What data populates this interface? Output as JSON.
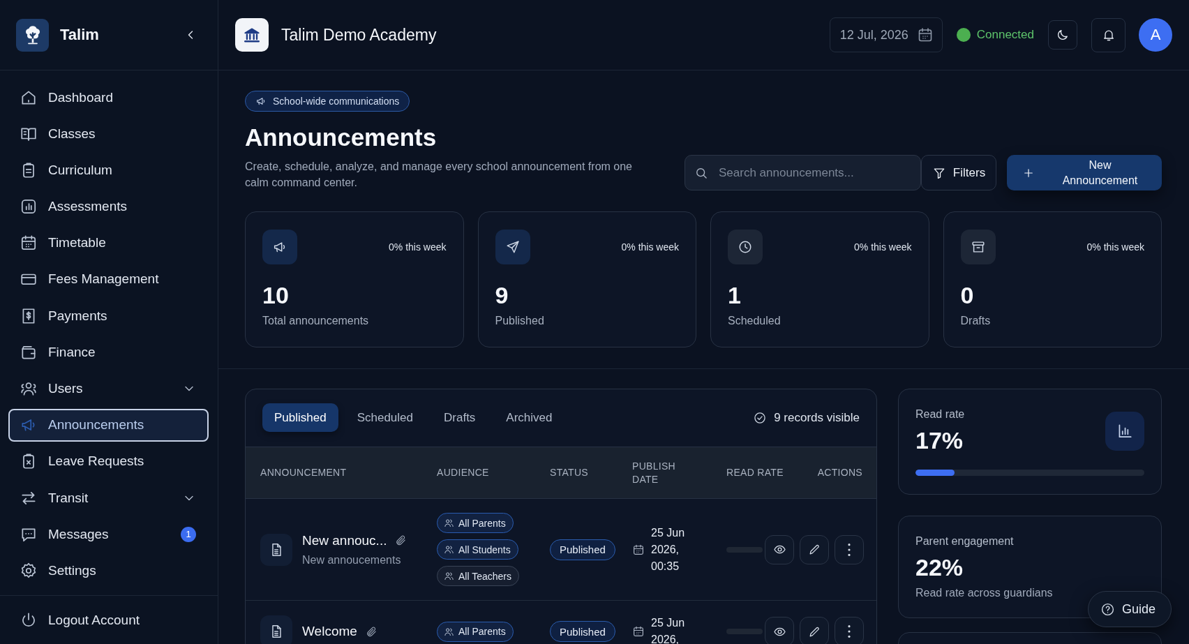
{
  "sidebar": {
    "brand": "Talim",
    "items": [
      {
        "label": "Dashboard",
        "selected": false
      },
      {
        "label": "Classes",
        "selected": false
      },
      {
        "label": "Curriculum",
        "selected": false
      },
      {
        "label": "Assessments",
        "selected": false
      },
      {
        "label": "Timetable",
        "selected": false
      },
      {
        "label": "Fees Management",
        "selected": false
      },
      {
        "label": "Payments",
        "selected": false
      },
      {
        "label": "Finance",
        "selected": false
      },
      {
        "label": "Users",
        "selected": false,
        "expanded": false
      },
      {
        "label": "Announcements",
        "selected": true
      },
      {
        "label": "Leave Requests",
        "selected": false
      },
      {
        "label": "Transit",
        "selected": false,
        "expanded": false
      },
      {
        "label": "Messages",
        "selected": false,
        "badge": "1"
      },
      {
        "label": "Settings",
        "selected": false
      }
    ],
    "logout": "Logout Account"
  },
  "header": {
    "school": "Talim Demo Academy",
    "date": "12 Jul, 2026",
    "connection": {
      "label": "Connected",
      "connected": true
    },
    "avatar": "A"
  },
  "intro": {
    "tag": "School-wide communications",
    "title": "Announcements",
    "description": "Create, schedule, analyze, and manage every school announcement from one calm command center.",
    "search": {
      "placeholder": "Search announcements..."
    },
    "filters": "Filters",
    "new_button": "New Announcement"
  },
  "stats": [
    {
      "value": "10",
      "label": "Total announcements",
      "trend": "0% this week",
      "color": "#14284a"
    },
    {
      "value": "9",
      "label": "Published",
      "trend": "0% this week",
      "color": "#14284a"
    },
    {
      "value": "1",
      "label": "Scheduled",
      "trend": "0% this week",
      "color": "#1d2636"
    },
    {
      "value": "0",
      "label": "Drafts",
      "trend": "0% this week",
      "color": "#1d2636"
    }
  ],
  "table": {
    "tabs": [
      {
        "label": "Published",
        "selected": true
      },
      {
        "label": "Scheduled",
        "selected": false
      },
      {
        "label": "Drafts",
        "selected": false
      },
      {
        "label": "Archived",
        "selected": false
      }
    ],
    "records": "9 records visible",
    "columns": [
      "ANNOUNCEMENT",
      "AUDIENCE",
      "STATUS",
      "PUBLISH DATE",
      "READ RATE",
      "ACTIONS"
    ],
    "rows": [
      {
        "title": "New annouc...",
        "attachment": true,
        "subtitle": "New annoucements",
        "audience": [
          {
            "label": "All Parents",
            "color": "#2a5cb0"
          },
          {
            "label": "All Students",
            "color": "#2a5cb0"
          },
          {
            "label": "All Teachers",
            "color": "#3a4456"
          }
        ],
        "status": "Published",
        "date": "25 Jun 2026, 00:35",
        "read_rate": {
          "level": 0
        }
      },
      {
        "title": "Welcome",
        "attachment": true,
        "audience": [
          {
            "label": "All Parents",
            "color": "#2a5cb0"
          }
        ],
        "status": "Published",
        "date": "25 Jun 2026,",
        "read_rate": {
          "level": 0
        }
      }
    ]
  },
  "insights": [
    {
      "kind": "meter",
      "label": "Read rate",
      "value": "17%",
      "level": 0.17
    },
    {
      "kind": "note",
      "label": "Parent engagement",
      "value": "22%",
      "note": "Read rate across guardians"
    }
  ],
  "guide": "Guide"
}
